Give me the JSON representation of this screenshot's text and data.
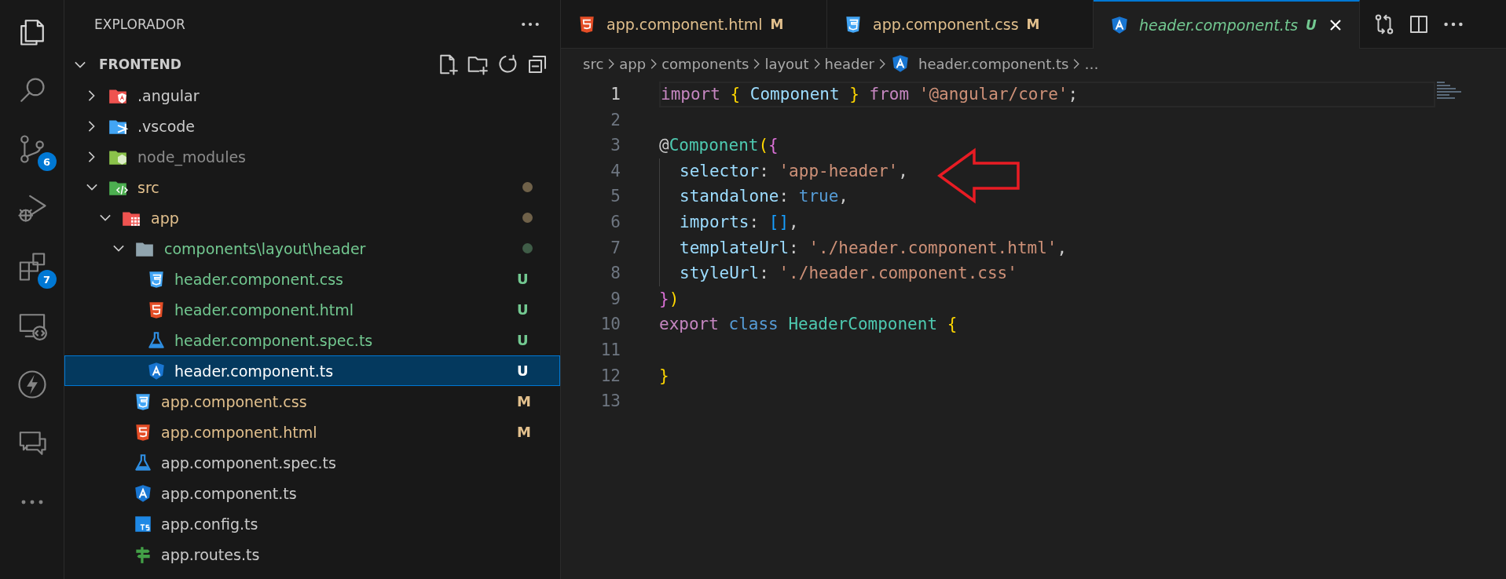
{
  "activity_bar": [
    {
      "kind": "explorer",
      "selected": true
    },
    {
      "kind": "search",
      "selected": false
    },
    {
      "kind": "source-control",
      "selected": false,
      "badge": "6"
    },
    {
      "kind": "run-debug",
      "selected": false
    },
    {
      "kind": "extensions",
      "selected": false,
      "badge": "7"
    },
    {
      "kind": "remote",
      "selected": false
    },
    {
      "kind": "lightning",
      "selected": false
    },
    {
      "kind": "chat",
      "selected": false
    },
    {
      "kind": "more",
      "selected": false
    }
  ],
  "sidebar": {
    "title": "EXPLORADOR",
    "section": {
      "label": "FRONTEND",
      "expanded": true
    },
    "tree": [
      {
        "label": ".angular",
        "kind": "folder-angular",
        "expanded": false,
        "color": "#cccccc",
        "selected": false
      },
      {
        "label": ".vscode",
        "kind": "folder-vscode",
        "expanded": false,
        "color": "#cccccc",
        "selected": false
      },
      {
        "label": "node_modules",
        "kind": "folder-node",
        "expanded": false,
        "color": "#8c8c8c",
        "selected": false
      },
      {
        "label": "src",
        "kind": "folder-src",
        "expanded": true,
        "color": "#e2c08d",
        "dot": {
          "color": "#6f6149"
        },
        "selected": false,
        "children": [
          {
            "label": "app",
            "kind": "folder-app",
            "expanded": true,
            "color": "#e2c08d",
            "dot": {
              "color": "#6f6149"
            },
            "selected": false,
            "children": [
              {
                "label": "components\\layout\\header",
                "kind": "folder",
                "expanded": true,
                "color": "#73c991",
                "dot": {
                  "color": "#3f5c47"
                },
                "selected": false,
                "children": [
                  {
                    "label": "header.component.css",
                    "kind": "css",
                    "color": "#73c991",
                    "letter": "U",
                    "selected": false
                  },
                  {
                    "label": "header.component.html",
                    "kind": "html",
                    "color": "#73c991",
                    "letter": "U",
                    "selected": false
                  },
                  {
                    "label": "header.component.spec.ts",
                    "kind": "spec",
                    "color": "#73c991",
                    "letter": "U",
                    "selected": false
                  },
                  {
                    "label": "header.component.ts",
                    "kind": "angular",
                    "letter": "U",
                    "selected": true
                  }
                ]
              },
              {
                "label": "app.component.css",
                "kind": "css",
                "color": "#e2c08d",
                "letter": "M",
                "selected": false
              },
              {
                "label": "app.component.html",
                "kind": "html",
                "color": "#e2c08d",
                "letter": "M",
                "selected": false
              },
              {
                "label": "app.component.spec.ts",
                "kind": "spec",
                "color": "#cccccc",
                "selected": false
              },
              {
                "label": "app.component.ts",
                "kind": "angular",
                "color": "#cccccc",
                "selected": false
              },
              {
                "label": "app.config.ts",
                "kind": "ts",
                "color": "#cccccc",
                "selected": false
              },
              {
                "label": "app.routes.ts",
                "kind": "routes",
                "color": "#cccccc",
                "selected": false
              }
            ]
          }
        ]
      }
    ]
  },
  "tabs": [
    {
      "label": "app.component.html",
      "kind": "html",
      "color": "#e2c08d",
      "letter": "M",
      "selected": false,
      "preview": false
    },
    {
      "label": "app.component.css",
      "kind": "css",
      "color": "#e2c08d",
      "letter": "M",
      "selected": false,
      "preview": false
    },
    {
      "label": "header.component.ts",
      "kind": "angular",
      "color": "#73c991",
      "letter": "U",
      "selected": true,
      "preview": true
    }
  ],
  "breadcrumbs": [
    {
      "label": "src",
      "kind": "text"
    },
    {
      "label": "app",
      "kind": "text"
    },
    {
      "label": "components",
      "kind": "text"
    },
    {
      "label": "layout",
      "kind": "text"
    },
    {
      "label": "header",
      "kind": "text"
    },
    {
      "label": "header.component.ts",
      "kind": "angular"
    },
    {
      "label": "…",
      "kind": "text"
    }
  ],
  "code": [
    {
      "number": "1",
      "current": true,
      "tokens": [
        {
          "text": "import ",
          "kind": "keyword"
        },
        {
          "text": "{",
          "kind": "brace1"
        },
        {
          "text": " Component ",
          "kind": "variable"
        },
        {
          "text": "}",
          "kind": "brace1"
        },
        {
          "text": " from ",
          "kind": "keyword"
        },
        {
          "text": "'@angular/core'",
          "kind": "string"
        },
        {
          "text": ";",
          "kind": "punct"
        }
      ]
    },
    {
      "number": "2",
      "current": false
    },
    {
      "number": "3",
      "current": false,
      "tokens": [
        {
          "text": "@",
          "kind": "punct"
        },
        {
          "text": "Component",
          "kind": "class"
        },
        {
          "text": "(",
          "kind": "brace1"
        },
        {
          "text": "{",
          "kind": "brace2"
        }
      ],
      "children": [
        {
          "number": "4",
          "current": false,
          "tokens": [
            {
              "text": "selector",
              "kind": "variable"
            },
            {
              "text": ": ",
              "kind": "punct"
            },
            {
              "text": "'app-header'",
              "kind": "string"
            },
            {
              "text": ",",
              "kind": "punct"
            }
          ]
        },
        {
          "number": "5",
          "current": false,
          "tokens": [
            {
              "text": "standalone",
              "kind": "variable"
            },
            {
              "text": ": ",
              "kind": "punct"
            },
            {
              "text": "true",
              "kind": "constant"
            },
            {
              "text": ",",
              "kind": "punct"
            }
          ]
        },
        {
          "number": "6",
          "current": false,
          "tokens": [
            {
              "text": "imports",
              "kind": "variable"
            },
            {
              "text": ": ",
              "kind": "punct"
            },
            {
              "text": "[]",
              "kind": "brace3"
            },
            {
              "text": ",",
              "kind": "punct"
            }
          ]
        },
        {
          "number": "7",
          "current": false,
          "tokens": [
            {
              "text": "templateUrl",
              "kind": "variable"
            },
            {
              "text": ": ",
              "kind": "punct"
            },
            {
              "text": "'./header.component.html'",
              "kind": "string"
            },
            {
              "text": ",",
              "kind": "punct"
            }
          ]
        },
        {
          "number": "8",
          "current": false,
          "tokens": [
            {
              "text": "styleUrl",
              "kind": "variable"
            },
            {
              "text": ": ",
              "kind": "punct"
            },
            {
              "text": "'./header.component.css'",
              "kind": "string"
            }
          ]
        }
      ]
    },
    {
      "number": "9",
      "current": false,
      "tokens": [
        {
          "text": "}",
          "kind": "brace2"
        },
        {
          "text": ")",
          "kind": "brace1"
        }
      ]
    },
    {
      "number": "10",
      "current": false,
      "tokens": [
        {
          "text": "export ",
          "kind": "keyword"
        },
        {
          "text": "class ",
          "kind": "constant"
        },
        {
          "text": "HeaderComponent ",
          "kind": "class"
        },
        {
          "text": "{",
          "kind": "brace1"
        }
      ]
    },
    {
      "number": "11",
      "current": false
    },
    {
      "number": "12",
      "current": false,
      "tokens": [
        {
          "text": "}",
          "kind": "brace1"
        }
      ]
    },
    {
      "number": "13",
      "current": false
    }
  ]
}
